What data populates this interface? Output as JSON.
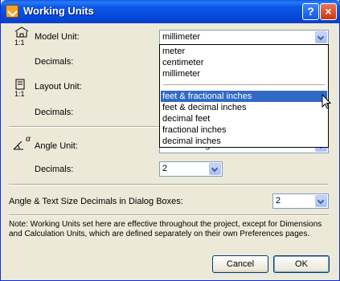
{
  "window": {
    "title": "Working Units",
    "help_label": "?",
    "close_label": "×"
  },
  "model_unit": {
    "label": "Model Unit:",
    "value": "millimeter",
    "decimals_label": "Decimals:"
  },
  "layout_unit": {
    "label": "Layout Unit:",
    "decimals_label": "Decimals:"
  },
  "dropdown": {
    "items": [
      "meter",
      "centimeter",
      "millimeter",
      "feet & fractional inches",
      "feet & decimal inches",
      "decimal feet",
      "fractional inches",
      "decimal inches"
    ],
    "selected": "feet & fractional inches"
  },
  "angle_unit": {
    "label": "Angle Unit:",
    "value": "decimal degrees",
    "decimals_label": "Decimals:",
    "decimals_value": "2"
  },
  "dialog_decimals": {
    "label": "Angle & Text Size Decimals in Dialog Boxes:",
    "value": "2"
  },
  "note": "Note: Working Units set here are effective throughout the project, except for Dimensions and Calculation Units, which are defined separately on their own Preferences pages.",
  "buttons": {
    "cancel": "Cancel",
    "ok": "OK"
  },
  "icons": {
    "model_scale": "1:1",
    "layout_scale": "1:1",
    "angle_symbol": "α"
  }
}
